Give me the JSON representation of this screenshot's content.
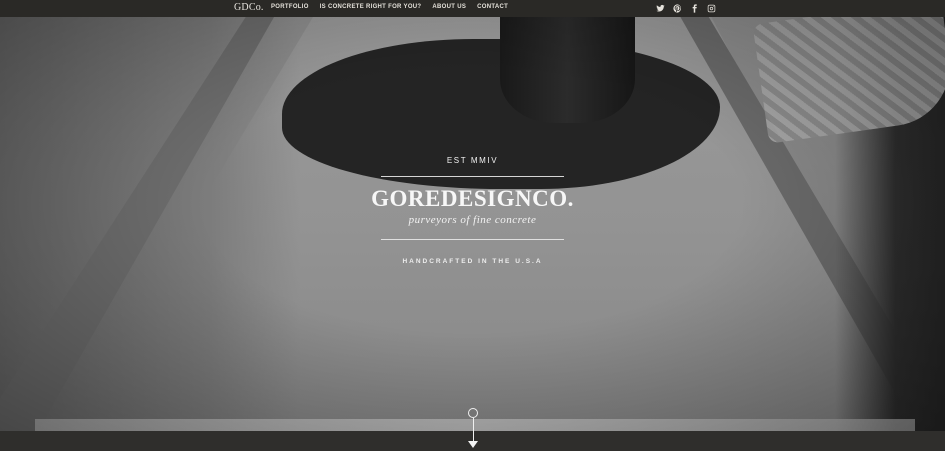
{
  "topbar": {
    "logo": "GDCo.",
    "nav": [
      {
        "label": "PORTFOLIO"
      },
      {
        "label": "IS CONCRETE RIGHT FOR YOU?"
      },
      {
        "label": "ABOUT US"
      },
      {
        "label": "CONTACT"
      }
    ],
    "social_icons": [
      "twitter-icon",
      "pinterest-icon",
      "facebook-icon",
      "instagram-icon"
    ]
  },
  "hero": {
    "est": "EST MMIV",
    "wordmark": {
      "part1": "GORE",
      "part2": "DESIGN",
      "part3": "CO."
    },
    "tagline": "purveyors of fine concrete",
    "handcrafted": "HANDCRAFTED IN THE U.S.A"
  },
  "scroll_indicator": {
    "icon": "scroll-down-arrow-icon"
  },
  "colors": {
    "topbar": "#2a2926",
    "text": "#ffffff",
    "footer": "#2f2e2c"
  }
}
